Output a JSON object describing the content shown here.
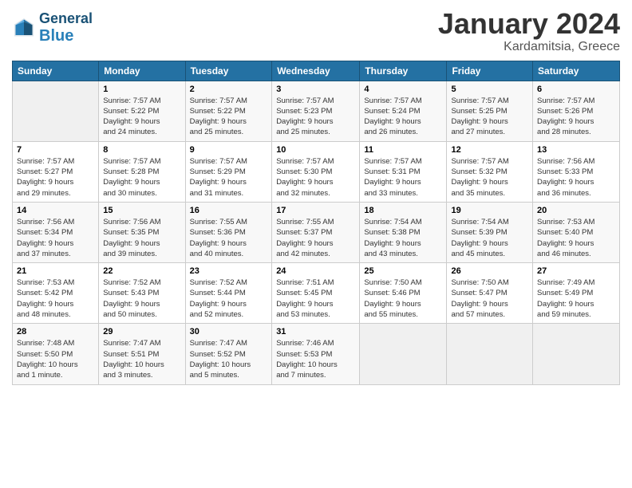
{
  "header": {
    "logo_line1": "General",
    "logo_line2": "Blue",
    "title": "January 2024",
    "subtitle": "Kardamitsia, Greece"
  },
  "weekdays": [
    "Sunday",
    "Monday",
    "Tuesday",
    "Wednesday",
    "Thursday",
    "Friday",
    "Saturday"
  ],
  "weeks": [
    [
      {
        "day": "",
        "info": ""
      },
      {
        "day": "1",
        "info": "Sunrise: 7:57 AM\nSunset: 5:22 PM\nDaylight: 9 hours\nand 24 minutes."
      },
      {
        "day": "2",
        "info": "Sunrise: 7:57 AM\nSunset: 5:22 PM\nDaylight: 9 hours\nand 25 minutes."
      },
      {
        "day": "3",
        "info": "Sunrise: 7:57 AM\nSunset: 5:23 PM\nDaylight: 9 hours\nand 25 minutes."
      },
      {
        "day": "4",
        "info": "Sunrise: 7:57 AM\nSunset: 5:24 PM\nDaylight: 9 hours\nand 26 minutes."
      },
      {
        "day": "5",
        "info": "Sunrise: 7:57 AM\nSunset: 5:25 PM\nDaylight: 9 hours\nand 27 minutes."
      },
      {
        "day": "6",
        "info": "Sunrise: 7:57 AM\nSunset: 5:26 PM\nDaylight: 9 hours\nand 28 minutes."
      }
    ],
    [
      {
        "day": "7",
        "info": "Sunrise: 7:57 AM\nSunset: 5:27 PM\nDaylight: 9 hours\nand 29 minutes."
      },
      {
        "day": "8",
        "info": "Sunrise: 7:57 AM\nSunset: 5:28 PM\nDaylight: 9 hours\nand 30 minutes."
      },
      {
        "day": "9",
        "info": "Sunrise: 7:57 AM\nSunset: 5:29 PM\nDaylight: 9 hours\nand 31 minutes."
      },
      {
        "day": "10",
        "info": "Sunrise: 7:57 AM\nSunset: 5:30 PM\nDaylight: 9 hours\nand 32 minutes."
      },
      {
        "day": "11",
        "info": "Sunrise: 7:57 AM\nSunset: 5:31 PM\nDaylight: 9 hours\nand 33 minutes."
      },
      {
        "day": "12",
        "info": "Sunrise: 7:57 AM\nSunset: 5:32 PM\nDaylight: 9 hours\nand 35 minutes."
      },
      {
        "day": "13",
        "info": "Sunrise: 7:56 AM\nSunset: 5:33 PM\nDaylight: 9 hours\nand 36 minutes."
      }
    ],
    [
      {
        "day": "14",
        "info": "Sunrise: 7:56 AM\nSunset: 5:34 PM\nDaylight: 9 hours\nand 37 minutes."
      },
      {
        "day": "15",
        "info": "Sunrise: 7:56 AM\nSunset: 5:35 PM\nDaylight: 9 hours\nand 39 minutes."
      },
      {
        "day": "16",
        "info": "Sunrise: 7:55 AM\nSunset: 5:36 PM\nDaylight: 9 hours\nand 40 minutes."
      },
      {
        "day": "17",
        "info": "Sunrise: 7:55 AM\nSunset: 5:37 PM\nDaylight: 9 hours\nand 42 minutes."
      },
      {
        "day": "18",
        "info": "Sunrise: 7:54 AM\nSunset: 5:38 PM\nDaylight: 9 hours\nand 43 minutes."
      },
      {
        "day": "19",
        "info": "Sunrise: 7:54 AM\nSunset: 5:39 PM\nDaylight: 9 hours\nand 45 minutes."
      },
      {
        "day": "20",
        "info": "Sunrise: 7:53 AM\nSunset: 5:40 PM\nDaylight: 9 hours\nand 46 minutes."
      }
    ],
    [
      {
        "day": "21",
        "info": "Sunrise: 7:53 AM\nSunset: 5:42 PM\nDaylight: 9 hours\nand 48 minutes."
      },
      {
        "day": "22",
        "info": "Sunrise: 7:52 AM\nSunset: 5:43 PM\nDaylight: 9 hours\nand 50 minutes."
      },
      {
        "day": "23",
        "info": "Sunrise: 7:52 AM\nSunset: 5:44 PM\nDaylight: 9 hours\nand 52 minutes."
      },
      {
        "day": "24",
        "info": "Sunrise: 7:51 AM\nSunset: 5:45 PM\nDaylight: 9 hours\nand 53 minutes."
      },
      {
        "day": "25",
        "info": "Sunrise: 7:50 AM\nSunset: 5:46 PM\nDaylight: 9 hours\nand 55 minutes."
      },
      {
        "day": "26",
        "info": "Sunrise: 7:50 AM\nSunset: 5:47 PM\nDaylight: 9 hours\nand 57 minutes."
      },
      {
        "day": "27",
        "info": "Sunrise: 7:49 AM\nSunset: 5:49 PM\nDaylight: 9 hours\nand 59 minutes."
      }
    ],
    [
      {
        "day": "28",
        "info": "Sunrise: 7:48 AM\nSunset: 5:50 PM\nDaylight: 10 hours\nand 1 minute."
      },
      {
        "day": "29",
        "info": "Sunrise: 7:47 AM\nSunset: 5:51 PM\nDaylight: 10 hours\nand 3 minutes."
      },
      {
        "day": "30",
        "info": "Sunrise: 7:47 AM\nSunset: 5:52 PM\nDaylight: 10 hours\nand 5 minutes."
      },
      {
        "day": "31",
        "info": "Sunrise: 7:46 AM\nSunset: 5:53 PM\nDaylight: 10 hours\nand 7 minutes."
      },
      {
        "day": "",
        "info": ""
      },
      {
        "day": "",
        "info": ""
      },
      {
        "day": "",
        "info": ""
      }
    ]
  ]
}
